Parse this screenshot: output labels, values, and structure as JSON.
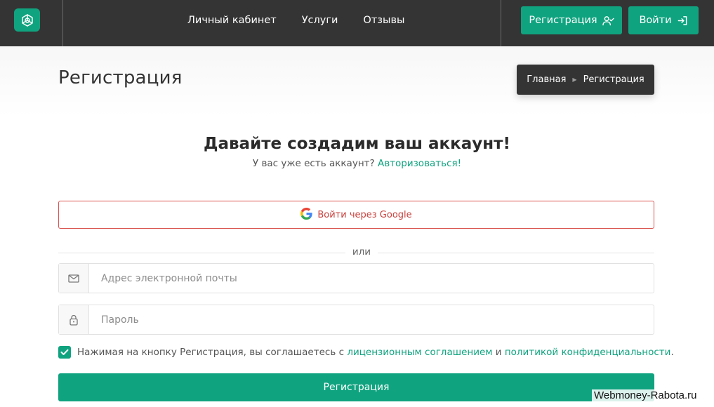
{
  "header": {
    "logo_icon": "chatgpt-logo-icon",
    "nav": [
      {
        "label": "Личный кабинет"
      },
      {
        "label": "Услуги"
      },
      {
        "label": "Отзывы"
      }
    ],
    "register_button": "Регистрация",
    "login_button": "Войти"
  },
  "page": {
    "title": "Регистрация",
    "breadcrumb": {
      "home": "Главная",
      "current": "Регистрация"
    }
  },
  "form": {
    "heading": "Давайте создадим ваш аккаунт!",
    "have_account": "У вас уже есть аккаунт?",
    "login_link": "Авторизоваться!",
    "google_button": "Войти через Google",
    "or": "или",
    "email_placeholder": "Адрес электронной почты",
    "password_placeholder": "Пароль",
    "terms_checked": true,
    "terms_prefix": "Нажимая на кнопку Регистрация, вы соглашаетесь с",
    "terms_link1": "лицензионным соглашением",
    "terms_and": "и",
    "terms_link2": "политикой конфиденциальности",
    "terms_end": ".",
    "submit": "Регистрация"
  },
  "watermark": "Webmoney-Rabota.ru",
  "colors": {
    "accent": "#10a37f",
    "header_bg": "#343434",
    "google_red": "#d9534f"
  }
}
